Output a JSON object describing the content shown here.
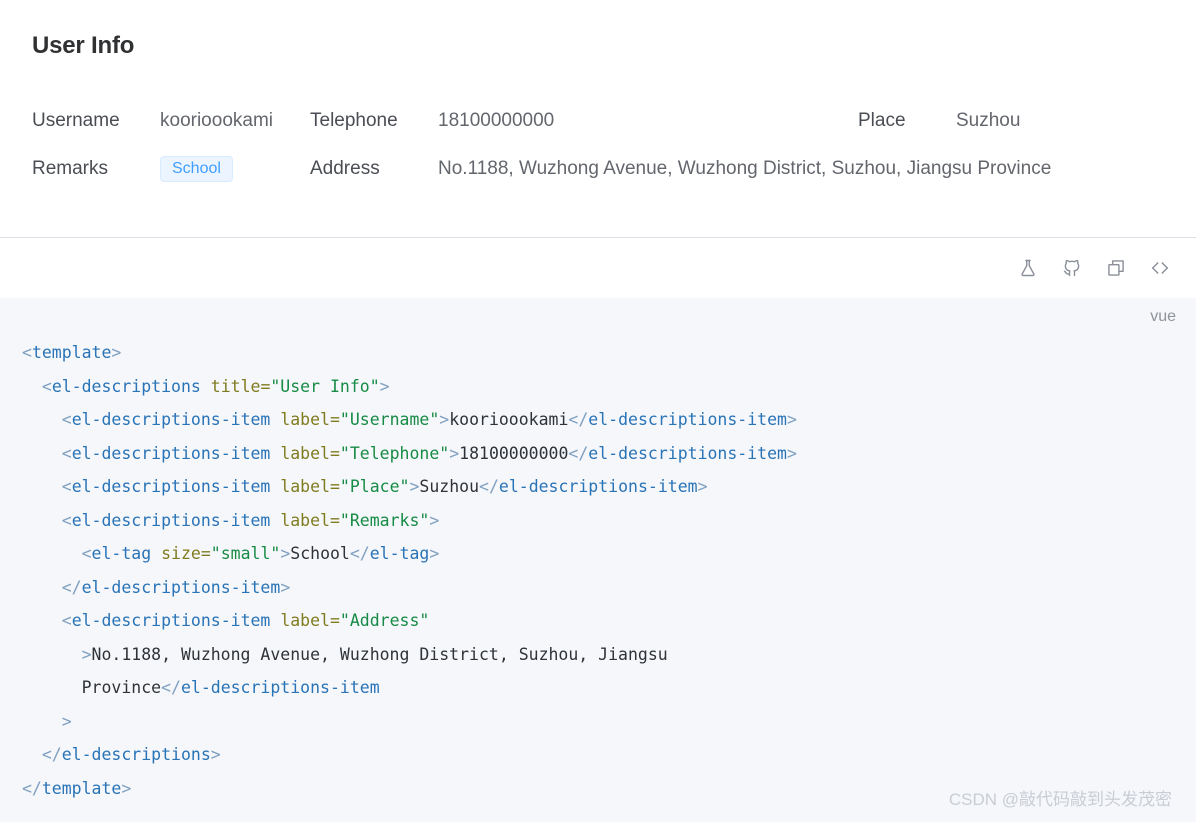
{
  "descriptions": {
    "title": "User Info",
    "rows": [
      {
        "cells": [
          {
            "label": "Username",
            "value": "koorioookami"
          },
          {
            "label": "Telephone",
            "value": "18100000000"
          },
          {
            "label": "Place",
            "value": "Suzhou"
          }
        ]
      },
      {
        "cells": [
          {
            "label": "Remarks",
            "tag": "School"
          },
          {
            "label": "Address",
            "value": "No.1188, Wuzhong Avenue, Wuzhong District, Suzhou, Jiangsu Province"
          }
        ]
      }
    ]
  },
  "toolbar": {
    "buttons": [
      {
        "name": "flask-icon",
        "label": "Open in Playground"
      },
      {
        "name": "github-icon",
        "label": "View on GitHub"
      },
      {
        "name": "copy-icon",
        "label": "Copy code"
      },
      {
        "name": "code-icon",
        "label": "Toggle source code"
      }
    ]
  },
  "code_block": {
    "language": "vue",
    "lines": [
      "<template>",
      "  <el-descriptions title=\"User Info\">",
      "    <el-descriptions-item label=\"Username\">koorioookami</el-descriptions-item>",
      "    <el-descriptions-item label=\"Telephone\">18100000000</el-descriptions-item>",
      "    <el-descriptions-item label=\"Place\">Suzhou</el-descriptions-item>",
      "    <el-descriptions-item label=\"Remarks\">",
      "      <el-tag size=\"small\">School</el-tag>",
      "    </el-descriptions-item>",
      "    <el-descriptions-item label=\"Address\"",
      "      >No.1188, Wuzhong Avenue, Wuzhong District, Suzhou, Jiangsu",
      "      Province</el-descriptions-item",
      "    >",
      "  </el-descriptions>",
      "</template>"
    ]
  },
  "watermark": {
    "text": "CSDN @敲代码敲到头发茂密"
  },
  "colors": {
    "tag_text": "#409eff",
    "tag_bg": "#ecf5ff",
    "tag_border": "#d9ecff",
    "code_bg": "#f5f7fa",
    "divider": "#dcdfe6",
    "label_text": "#4a4d54",
    "value_text": "#63666d",
    "title_text": "#303133"
  }
}
